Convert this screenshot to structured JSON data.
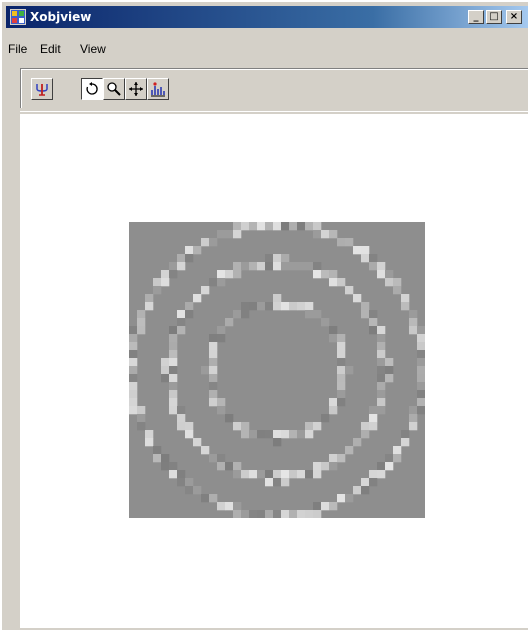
{
  "window": {
    "title": "Xobjview",
    "buttons": {
      "minimize": "_",
      "maximize": "□",
      "close": "×"
    }
  },
  "menubar": {
    "items": [
      "File",
      "Edit",
      "View"
    ]
  },
  "toolbar": {
    "buttons": [
      {
        "name": "reset-view",
        "icon": "fork-icon",
        "pressed": false
      },
      {
        "name": "rotate",
        "icon": "rotate-icon",
        "pressed": true
      },
      {
        "name": "zoom",
        "icon": "magnifier-icon",
        "pressed": false
      },
      {
        "name": "pan",
        "icon": "move-icon",
        "pressed": false
      },
      {
        "name": "data-cursor",
        "icon": "data-cursor-icon",
        "pressed": false
      }
    ]
  },
  "viewer": {
    "content": "concentric rings grayscale image",
    "background_color": "#8e8e8e",
    "rings": [
      3,
      4,
      5
    ],
    "grid_size": 37
  },
  "colors": {
    "titlebar_start": "#0a246a",
    "titlebar_end": "#a6caf0",
    "window_face": "#d4d0c8",
    "canvas": "#ffffff"
  }
}
